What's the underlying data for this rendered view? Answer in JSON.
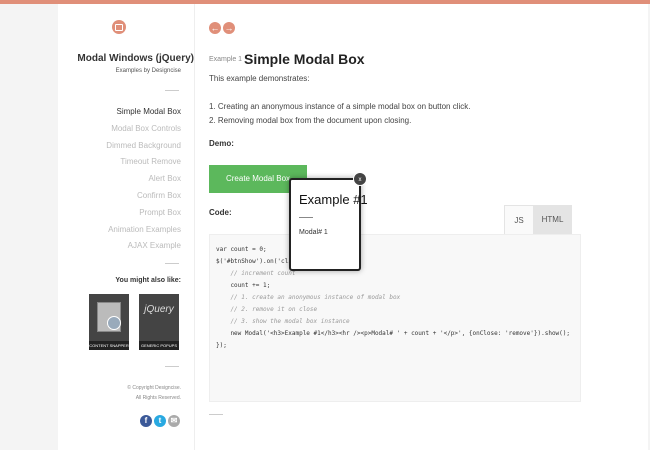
{
  "sidebar": {
    "title": "Modal Windows (jQuery)",
    "subtitle": "Examples by Designcise",
    "nav": [
      "Simple Modal Box",
      "Modal Box Controls",
      "Dimmed Background",
      "Timeout Remove",
      "Alert Box",
      "Confirm Box",
      "Prompt Box",
      "Animation Examples",
      "AJAX Example"
    ],
    "active_index": 0,
    "also_like": "You might also like:",
    "thumbnails": [
      "CONTENT SNAPPER",
      "GENERIC POPUPS"
    ],
    "thumb2_logo": "jQuery",
    "copyright": [
      "© Copyright Designcise.",
      "All Rights Reserved."
    ],
    "social_icons": [
      "facebook-icon",
      "twitter-icon",
      "email-icon"
    ],
    "social_glyphs": [
      "f",
      "t",
      "✉"
    ]
  },
  "main": {
    "prev_glyph": "←",
    "next_glyph": "→",
    "example_label": "Example 1",
    "title": "Simple Modal Box",
    "intro": "This example demonstrates:",
    "steps": [
      "1. Creating an anonymous instance of a simple modal box on button click.",
      "2. Removing modal box from the document upon closing."
    ],
    "demo_label": "Demo:",
    "create_button": "Create Modal Box",
    "code_label": "Code:",
    "tabs": [
      "JS",
      "HTML"
    ],
    "code_lines": [
      "var count = 0;",
      "",
      "$('#btnShow').on('click', function() {",
      "    // increment count",
      "    count += 1;",
      "",
      "    // 1. create an anonymous instance of modal box",
      "    // 2. remove it on close",
      "    // 3. show the modal box instance",
      "    new Modal('<h3>Example #1</h3><hr /><p>Modal# ' + count + '</p>', {onClose: 'remove'}).show();",
      "});"
    ]
  },
  "modal": {
    "title": "Example #1",
    "body": "Modal# 1",
    "close_glyph": "x"
  },
  "colors": {
    "accent": "#e08f79",
    "button": "#5cb85c"
  }
}
